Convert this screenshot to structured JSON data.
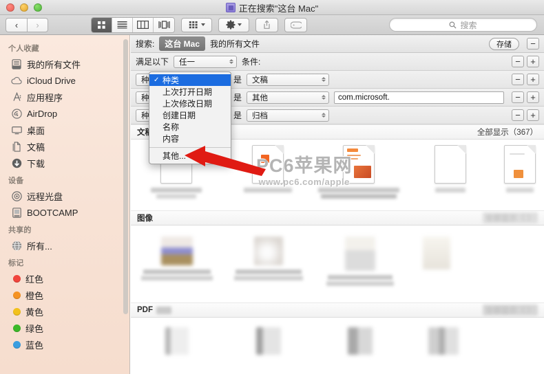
{
  "window": {
    "title": "正在搜索\"这台 Mac\"",
    "title_icon": "search-folder-icon",
    "traffic_lights": [
      "close-button",
      "minimize-button",
      "maximize-button"
    ]
  },
  "toolbar": {
    "back_label": "‹",
    "forward_label": "›",
    "view_buttons": [
      {
        "name": "icon-view",
        "active": true
      },
      {
        "name": "list-view",
        "active": false
      },
      {
        "name": "column-view",
        "active": false
      },
      {
        "name": "coverflow-view",
        "active": false
      }
    ],
    "arrange_icon": "arrange-by-icon",
    "action_icon": "gear-icon",
    "share_icon": "share-icon",
    "tag_icon": "tag-icon",
    "search": {
      "placeholder": "搜索",
      "value": "",
      "icon": "search-icon"
    }
  },
  "sidebar": {
    "sections": [
      {
        "header": "个人收藏",
        "items": [
          {
            "label": "我的所有文件",
            "icon": "all-my-files-icon"
          },
          {
            "label": "iCloud Drive",
            "icon": "cloud-icon"
          },
          {
            "label": "应用程序",
            "icon": "applications-icon"
          },
          {
            "label": "AirDrop",
            "icon": "airdrop-icon"
          },
          {
            "label": "桌面",
            "icon": "desktop-icon"
          },
          {
            "label": "文稿",
            "icon": "documents-icon"
          },
          {
            "label": "下载",
            "icon": "downloads-icon"
          }
        ]
      },
      {
        "header": "设备",
        "items": [
          {
            "label": "远程光盘",
            "icon": "remote-disc-icon"
          },
          {
            "label": "BOOTCAMP",
            "icon": "hard-drive-icon"
          }
        ]
      },
      {
        "header": "共享的",
        "items": [
          {
            "label": "所有...",
            "icon": "network-icon"
          }
        ]
      },
      {
        "header": "标记",
        "items": [
          {
            "label": "红色",
            "icon": "tag-dot-icon",
            "color": "#f1453d"
          },
          {
            "label": "橙色",
            "icon": "tag-dot-icon",
            "color": "#f59324"
          },
          {
            "label": "黄色",
            "icon": "tag-dot-icon",
            "color": "#f2c11c"
          },
          {
            "label": "绿色",
            "icon": "tag-dot-icon",
            "color": "#3cb829"
          },
          {
            "label": "蓝色",
            "icon": "tag-dot-icon",
            "color": "#3b9ee0"
          }
        ]
      }
    ]
  },
  "search_bar": {
    "label": "搜索:",
    "scope_selected": "这台 Mac",
    "scope_other": "我的所有文件",
    "save_label": "存储",
    "remove_label": "−",
    "add_label": "+"
  },
  "match_row": {
    "prefix": "满足以下",
    "operator": "任一",
    "suffix": "条件:"
  },
  "rules": [
    {
      "attribute": "种类",
      "comparator": "是",
      "value": "文稿",
      "text_value": ""
    },
    {
      "attribute": "种类",
      "comparator": "是",
      "value": "其他",
      "text_value": "com.microsoft."
    },
    {
      "attribute": "种类",
      "comparator": "是",
      "value": "归档",
      "text_value": ""
    }
  ],
  "dropdown": {
    "open": true,
    "items": [
      {
        "label": "种类",
        "checked": true,
        "selected": true
      },
      {
        "label": "上次打开日期",
        "checked": false,
        "selected": false
      },
      {
        "label": "上次修改日期",
        "checked": false,
        "selected": false
      },
      {
        "label": "创建日期",
        "checked": false,
        "selected": false
      },
      {
        "label": "名称",
        "checked": false,
        "selected": false
      },
      {
        "label": "内容",
        "checked": false,
        "selected": false
      },
      {
        "separator": true
      },
      {
        "label": "其他...",
        "checked": false,
        "selected": false
      }
    ]
  },
  "results": {
    "sections": [
      {
        "title": "文稿",
        "show_all": "全部显示（367）",
        "show_all_blurred": false,
        "title_blurred": false
      },
      {
        "title": "图像",
        "show_all": "全部显示（   ）",
        "show_all_blurred": true,
        "title_blurred": false
      },
      {
        "title": "PDF",
        "show_all": "全部显示（   ）",
        "show_all_blurred": true,
        "title_blurred": true
      }
    ]
  },
  "watermark": {
    "main": "PC6苹果网",
    "sub": "www.pc6.com/apple"
  },
  "annotation": {
    "arrow_color": "#e01b13",
    "points_to": "其他..."
  }
}
